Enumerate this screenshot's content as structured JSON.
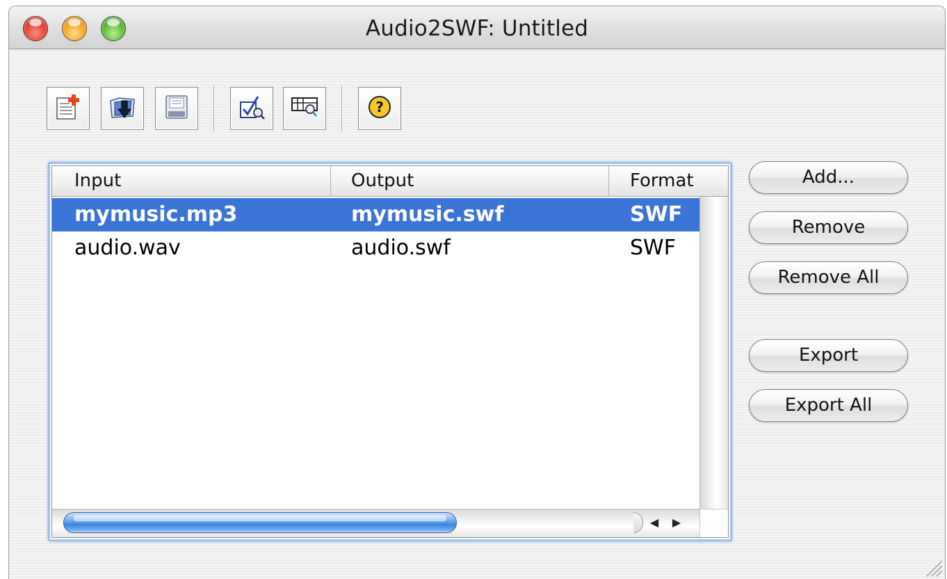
{
  "window": {
    "title": "Audio2SWF: Untitled"
  },
  "toolbar": {
    "buttons": [
      {
        "name": "new-document",
        "icon": "new-document-icon"
      },
      {
        "name": "open",
        "icon": "open-folder-icon"
      },
      {
        "name": "save",
        "icon": "save-disk-icon"
      },
      {
        "name": "check",
        "icon": "checklist-magnify-icon"
      },
      {
        "name": "preview",
        "icon": "preview-magnify-icon"
      },
      {
        "name": "help",
        "icon": "help-icon",
        "glyph": "?"
      }
    ]
  },
  "table": {
    "columns": [
      "Input",
      "Output",
      "Format"
    ],
    "rows": [
      {
        "input": "mymusic.mp3",
        "output": "mymusic.swf",
        "format": "SWF",
        "selected": true
      },
      {
        "input": "audio.wav",
        "output": "audio.swf",
        "format": "SWF",
        "selected": false
      }
    ],
    "selection_color": "#3a74d6",
    "scroll": {
      "left_arrow": "◀",
      "right_arrow": "▶"
    }
  },
  "actions": {
    "add": "Add...",
    "remove": "Remove",
    "remove_all": "Remove All",
    "export": "Export",
    "export_all": "Export All"
  }
}
